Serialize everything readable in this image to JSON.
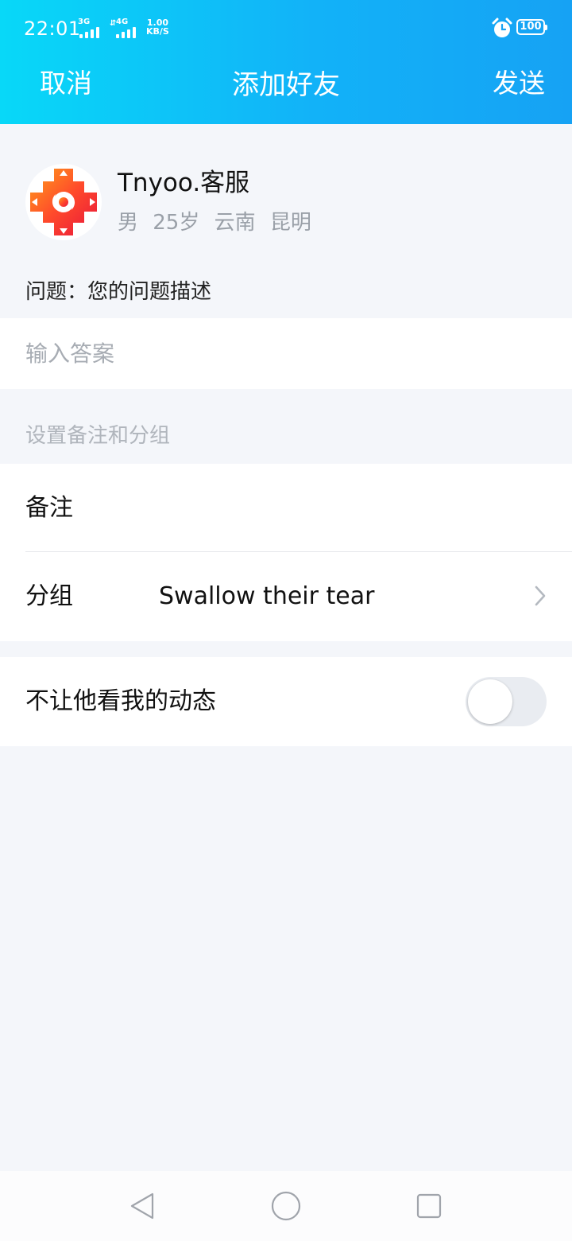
{
  "status_bar": {
    "time": "22:01",
    "signal_1_label": "3G",
    "signal_2_label": "4G",
    "net_speed_value": "1.00",
    "net_speed_unit": "KB/S",
    "battery": "100",
    "alarm_icon": "alarm-clock-icon"
  },
  "nav": {
    "cancel_label": "取消",
    "title": "添加好友",
    "send_label": "发送"
  },
  "profile": {
    "name": "Tnyoo.客服",
    "meta": "男 25岁 云南 昆明"
  },
  "question": {
    "text": "问题：您的问题描述"
  },
  "answer": {
    "placeholder": "输入答案",
    "value": ""
  },
  "settings": {
    "section_label": "设置备注和分组",
    "remark_label": "备注",
    "remark_value": "",
    "group_label": "分组",
    "group_value": "Swallow their tear"
  },
  "privacy": {
    "hide_moments_label": "不让他看我的动态",
    "hide_moments_enabled": false
  },
  "colors": {
    "header_start": "#08d8f8",
    "header_end": "#16a2f4",
    "background": "#f4f6fa",
    "muted_text": "#9aa0a8"
  }
}
